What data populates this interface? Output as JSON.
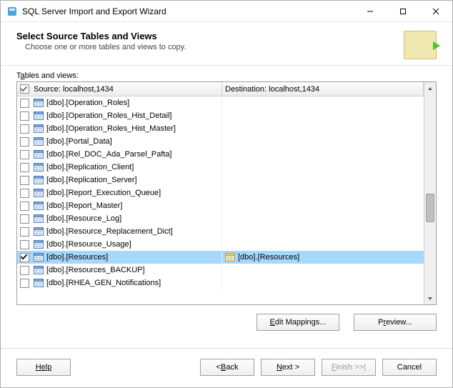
{
  "window": {
    "title": "SQL Server Import and Export Wizard"
  },
  "header": {
    "title": "Select Source Tables and Views",
    "subtitle": "Choose one or more tables and views to copy."
  },
  "list": {
    "label_before": "T",
    "label_mnemonic": "a",
    "label_after": "bles and views:",
    "source_header": "Source: localhost,1434",
    "destination_header": "Destination: localhost,1434"
  },
  "rows": [
    {
      "checked": false,
      "selected": false,
      "source": "[dbo].[Operation_Roles]",
      "destination": ""
    },
    {
      "checked": false,
      "selected": false,
      "source": "[dbo].[Operation_Roles_Hist_Detail]",
      "destination": ""
    },
    {
      "checked": false,
      "selected": false,
      "source": "[dbo].[Operation_Roles_Hist_Master]",
      "destination": ""
    },
    {
      "checked": false,
      "selected": false,
      "source": "[dbo].[Portal_Data]",
      "destination": ""
    },
    {
      "checked": false,
      "selected": false,
      "source": "[dbo].[Rel_DOC_Ada_Parsel_Pafta]",
      "destination": ""
    },
    {
      "checked": false,
      "selected": false,
      "source": "[dbo].[Replication_Client]",
      "destination": ""
    },
    {
      "checked": false,
      "selected": false,
      "source": "[dbo].[Replication_Server]",
      "destination": ""
    },
    {
      "checked": false,
      "selected": false,
      "source": "[dbo].[Report_Execution_Queue]",
      "destination": ""
    },
    {
      "checked": false,
      "selected": false,
      "source": "[dbo].[Report_Master]",
      "destination": ""
    },
    {
      "checked": false,
      "selected": false,
      "source": "[dbo].[Resource_Log]",
      "destination": ""
    },
    {
      "checked": false,
      "selected": false,
      "source": "[dbo].[Resource_Replacement_Dict]",
      "destination": ""
    },
    {
      "checked": false,
      "selected": false,
      "source": "[dbo].[Resource_Usage]",
      "destination": ""
    },
    {
      "checked": true,
      "selected": true,
      "source": "[dbo].[Resources]",
      "destination": "[dbo].[Resources]"
    },
    {
      "checked": false,
      "selected": false,
      "source": "[dbo].[Resources_BACKUP]",
      "destination": ""
    },
    {
      "checked": false,
      "selected": false,
      "source": "[dbo].[RHEA_GEN_Notifications]",
      "destination": ""
    }
  ],
  "actions": {
    "edit_mappings_before": "",
    "edit_mappings_mnemonic": "E",
    "edit_mappings_after": "dit Mappings...",
    "preview_before": "P",
    "preview_mnemonic": "r",
    "preview_after": "eview..."
  },
  "footer": {
    "help": "Help",
    "back_before": "< ",
    "back_mnemonic": "B",
    "back_after": "ack",
    "next_before": "",
    "next_mnemonic": "N",
    "next_after": "ext >",
    "finish_before": "",
    "finish_mnemonic": "F",
    "finish_after": "inish >>|",
    "cancel": "Cancel"
  }
}
